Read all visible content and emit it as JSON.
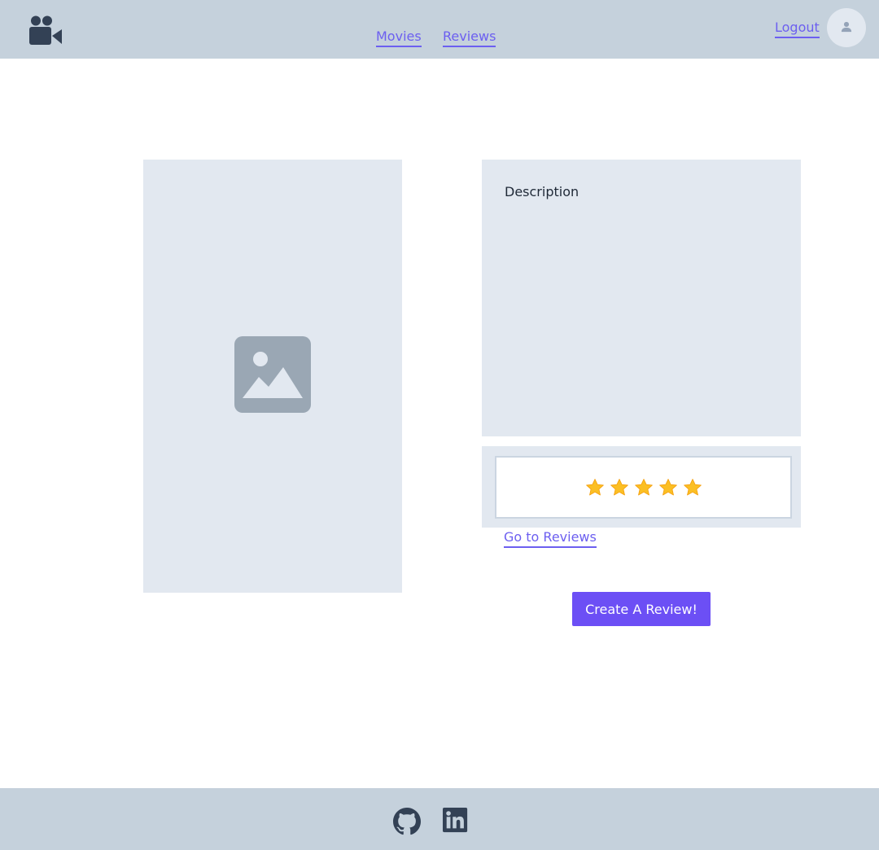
{
  "header": {
    "logo_icon": "video-camera-icon",
    "nav": [
      {
        "label": "Movies"
      },
      {
        "label": "Reviews"
      }
    ],
    "logout_label": "Logout",
    "avatar_icon": "user-icon"
  },
  "movie": {
    "poster_icon": "image-placeholder-icon",
    "description_title": "Description",
    "rating": 5,
    "rating_max": 5,
    "goto_reviews_label": "Go to Reviews",
    "create_review_label": "Create A Review!"
  },
  "footer": {
    "icons": [
      "github-icon",
      "linkedin-icon"
    ]
  },
  "colors": {
    "header_bg": "#c5d1dc",
    "panel_bg": "#e2e8f0",
    "link": "#6c5ff0",
    "button": "#6c4ff5",
    "star": "#fbbf24"
  }
}
